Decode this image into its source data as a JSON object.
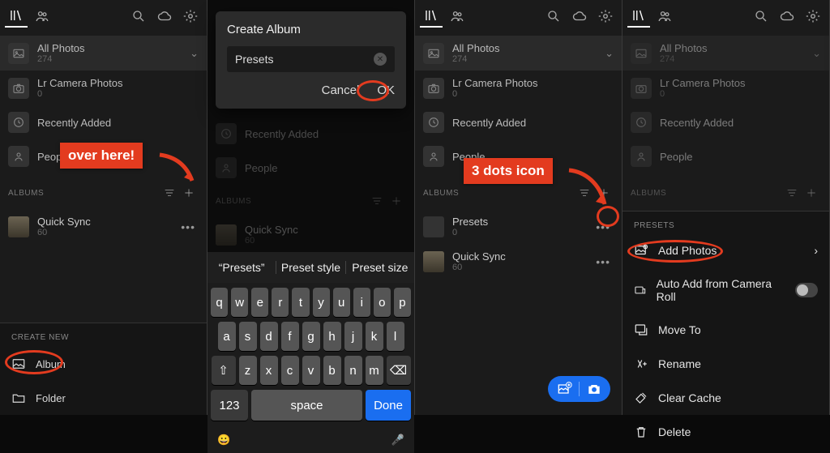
{
  "annotation": {
    "over_here": "over here!",
    "three_dots": "3 dots icon"
  },
  "common": {
    "all_photos": "All Photos",
    "count_274": "274",
    "lr_camera": "Lr Camera Photos",
    "zero": "0",
    "recently_added": "Recently Added",
    "people": "People",
    "albums_label": "ALBUMS",
    "quick_sync": "Quick Sync",
    "qs_count": "60",
    "presets": "Presets"
  },
  "pane1": {
    "create_new": "CREATE NEW",
    "album": "Album",
    "folder": "Folder"
  },
  "pane2": {
    "dialog_title": "Create Album",
    "input_value": "Presets",
    "cancel": "Cancel",
    "ok": "OK",
    "sugg1": "“Presets”",
    "sugg2": "Preset style",
    "sugg3": "Preset size",
    "keys_row1": [
      "q",
      "w",
      "e",
      "r",
      "t",
      "y",
      "u",
      "i",
      "o",
      "p"
    ],
    "keys_row2": [
      "a",
      "s",
      "d",
      "f",
      "g",
      "h",
      "j",
      "k",
      "l"
    ],
    "keys_row3": [
      "z",
      "x",
      "c",
      "v",
      "b",
      "n",
      "m"
    ],
    "num_key": "123",
    "space": "space",
    "done": "Done"
  },
  "pane3": {
    "presets_count": "0"
  },
  "pane4": {
    "menu_header": "PRESETS",
    "add_photos": "Add Photos",
    "auto_add": "Auto Add from Camera Roll",
    "move_to": "Move To",
    "rename": "Rename",
    "clear_cache": "Clear Cache",
    "delete": "Delete"
  }
}
